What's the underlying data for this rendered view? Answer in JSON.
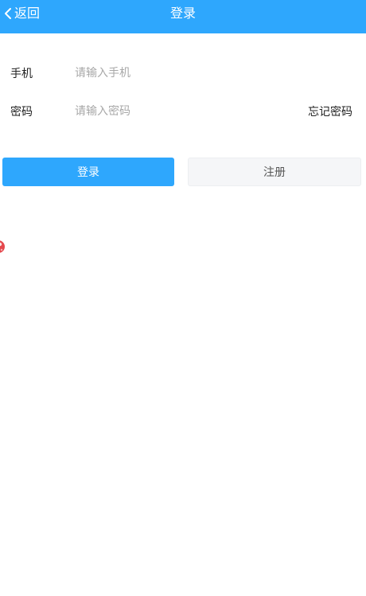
{
  "header": {
    "back_label": "返回",
    "title": "登录",
    "back_icon": "chevron-left-icon",
    "background": "#2ea7fd"
  },
  "form": {
    "phone": {
      "label": "手机",
      "placeholder": "请输入手机",
      "value": ""
    },
    "password": {
      "label": "密码",
      "placeholder": "请输入密码",
      "value": ""
    },
    "forgot_label": "忘记密码"
  },
  "actions": {
    "login_label": "登录",
    "register_label": "注册"
  },
  "floating_widget": {
    "icon": "red-badge-icon"
  },
  "colors": {
    "accent": "#2ea7fd",
    "secondary_button_bg": "#f5f6f8",
    "widget_red": "#e5484d"
  }
}
